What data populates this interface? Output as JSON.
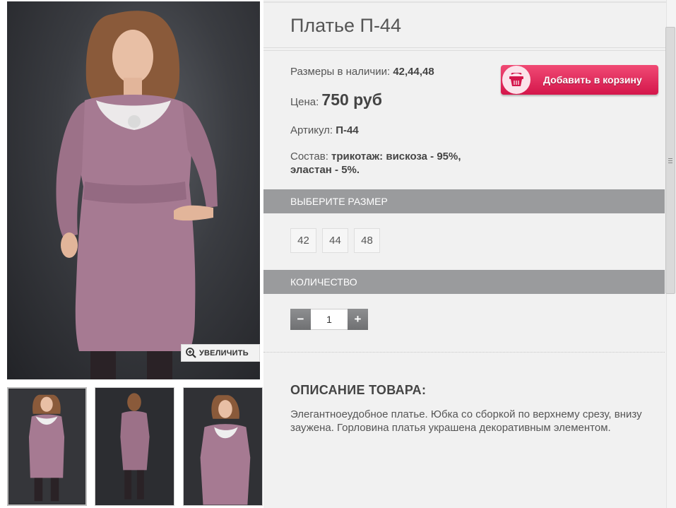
{
  "product": {
    "title": "Платье П-44",
    "sizes_label": "Размеры в наличии:",
    "sizes_value": "42,44,48",
    "price_label": "Цена:",
    "price_value": "750 руб",
    "sku_label": "Артикул:",
    "sku_value": "П-44",
    "composition_label": "Состав:",
    "composition_value": "трикотаж: вискоза - 95%, эластан - 5%."
  },
  "cart_button": {
    "label": "Добавить в корзину",
    "icon": "basket-icon",
    "color": "#e2245a"
  },
  "gallery": {
    "zoom_label": "УВЕЛИЧИТЬ",
    "zoom_icon": "magnifier-plus-icon",
    "thumbnail_count": 3,
    "dress_color": "#a67a92"
  },
  "size_section": {
    "heading": "ВЫБЕРИТЕ РАЗМЕР",
    "options": [
      "42",
      "44",
      "48"
    ]
  },
  "quantity_section": {
    "heading": "КОЛИЧЕСТВО",
    "value": "1",
    "minus": "−",
    "plus": "+"
  },
  "description": {
    "heading": "ОПИСАНИЕ ТОВАРА:",
    "text": "Элегантноеудобное платье. Юбка со сборкой по верхнему срезу, внизу заужена. Горловина платья украшена декоративным элементом."
  }
}
